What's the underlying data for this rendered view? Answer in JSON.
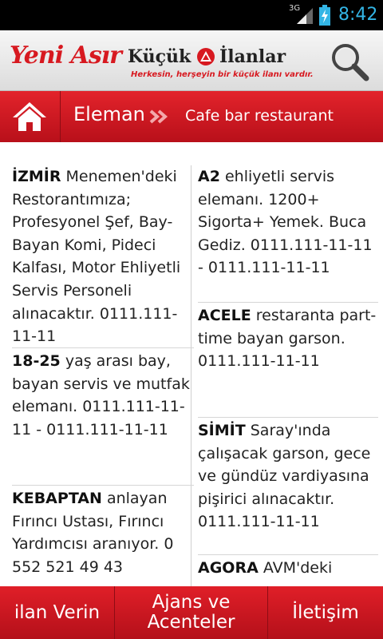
{
  "statusbar": {
    "network": "3G",
    "time": "8:42"
  },
  "header": {
    "logo_primary": "Yeni Asır",
    "logo_word1": "Küçük",
    "logo_word2": "İlanlar",
    "slogan": "Herkesin, herşeyin bir küçük ilanı vardır."
  },
  "nav": {
    "category": "Eleman",
    "subcategory": "Cafe bar restaurant"
  },
  "ads_left": [
    {
      "keyword": "İZMİR",
      "text": " Menemen'deki Restorantımıza; Profesyonel Şef, Bay-Bayan Komi, Pideci Kalfası, Motor Ehliyetli Servis Personeli alınacaktır. 0111.111-11-11"
    },
    {
      "keyword": "18-25",
      "text": " yaş arası bay, bayan servis ve mutfak elemanı. 0111.111-11-11 - 0111.111-11-11"
    },
    {
      "keyword": "KEBAPTAN",
      "text": " anlayan Fırıncı Ustası, Fırıncı Yardımcısı aranıyor. 0 552 521 49 43"
    }
  ],
  "ads_right": [
    {
      "keyword": "A2",
      "text": " ehliyetli servis elemanı. 1200+ Sigorta+ Yemek. Buca Gediz. 0111.111-11-11 - 0111.111-11-11"
    },
    {
      "keyword": "ACELE",
      "text": " restaranta part-time bayan garson. 0111.111-11-11"
    },
    {
      "keyword": "SİMİT",
      "text": " Saray'ında çalışacak garson, gece ve gündüz vardiyasına pişirici alınacaktır. 0111.111-11-11"
    },
    {
      "keyword": "AGORA",
      "text": " AVM'deki"
    }
  ],
  "bottom_tabs": [
    {
      "label": "ilan Verin"
    },
    {
      "label": "Ajans ve Acenteler"
    },
    {
      "label": "İletişim"
    }
  ]
}
